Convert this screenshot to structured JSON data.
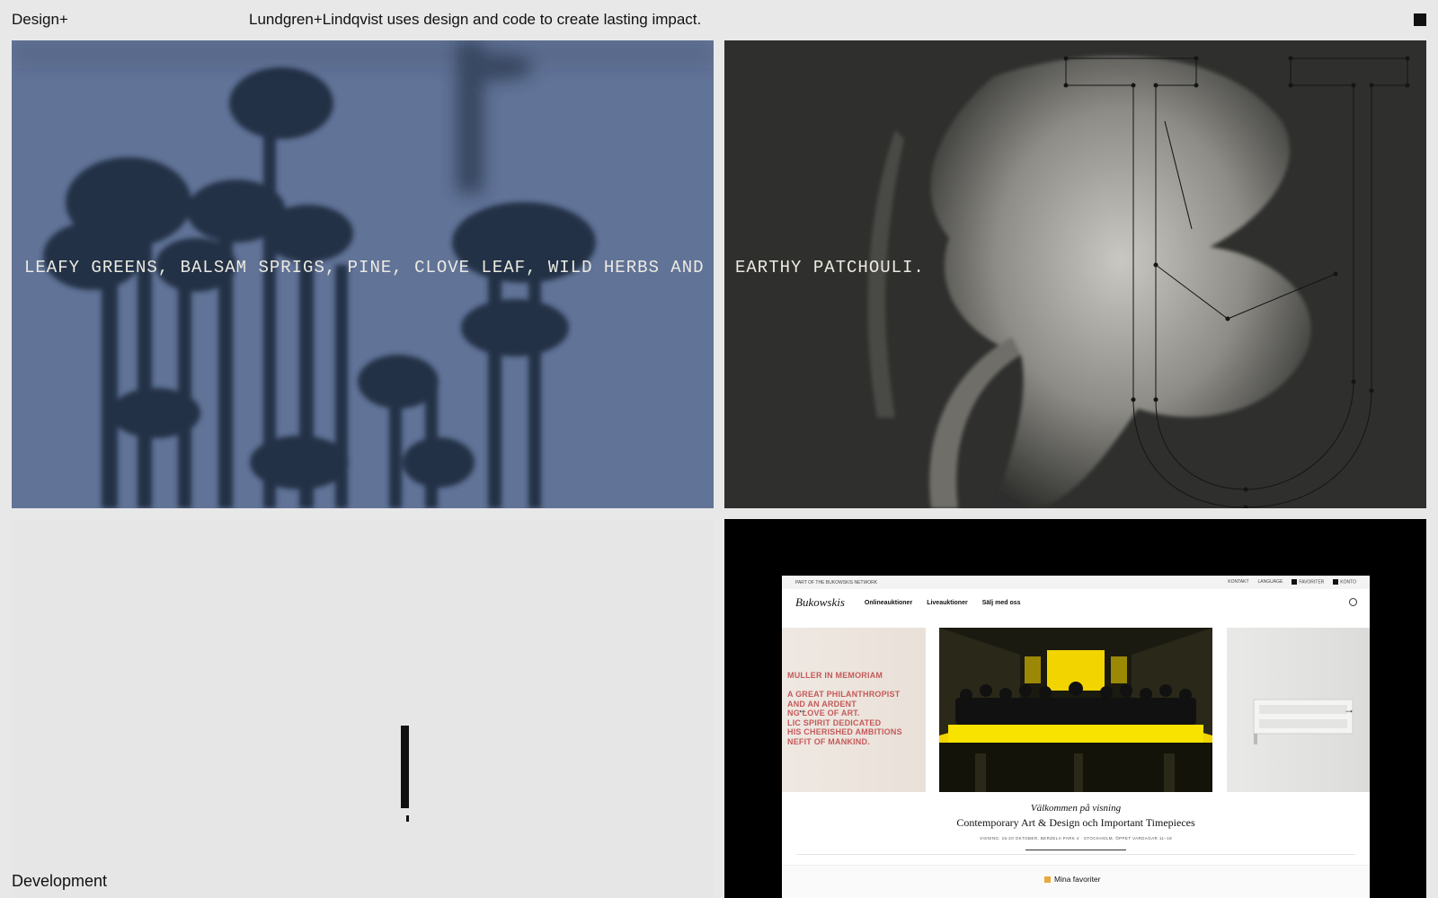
{
  "header": {
    "brand": "Design+",
    "tagline": "Lundgren+Lindqvist uses design and code to create lasting impact.",
    "menu_icon": "menu-square-icon"
  },
  "tiles": [
    {
      "caption": "LEAFY GREENS, BALSAM SPRIGS, PINE, CLOVE LEAF, WILD HERBS AND",
      "image": "blue-flower-silhouette-photo"
    },
    {
      "caption": "EARTHY PATCHOULI.",
      "image": "white-flower-photo-with-letter-outline"
    },
    {
      "label": "Development"
    },
    {
      "image": "bukowskis-website-mockup"
    }
  ],
  "mockup": {
    "topbar_left": "PART OF THE BUKOWSKIS NETWORK",
    "topbar_links": [
      "KONTAKT",
      "LANGUAGE",
      "FAVORITER",
      "KONTO"
    ],
    "logo": "Bukowskis",
    "nav": [
      "Onlineauktioner",
      "Liveauktioner",
      "Sälj med oss"
    ],
    "slide_left_text": "MULLER IN MEMORIAM\n\nA GREAT PHILANTHROPIST\nAND AN ARDENT\nNG LOVE OF ART.\nLIC SPIRIT DEDICATED\nHIS CHERISHED AMBITIONS\nNEFIT OF MANKIND.",
    "welcome_title": "Välkommen på visning",
    "welcome_subtitle": "Contemporary Art & Design och Important Timepieces",
    "welcome_details": "VISNING: 15-20 OKTOBER, BERZELII PARK 4 · STOCKHOLM, ÖPPET VARDAGAR 11–18",
    "favorites": "Mina favoriter"
  },
  "colors": {
    "background": "#e8e8e8",
    "tile_blue": "#5d6f92",
    "tile_dark": "#2f2f2d",
    "mockup_yellow": "#f2d400"
  }
}
